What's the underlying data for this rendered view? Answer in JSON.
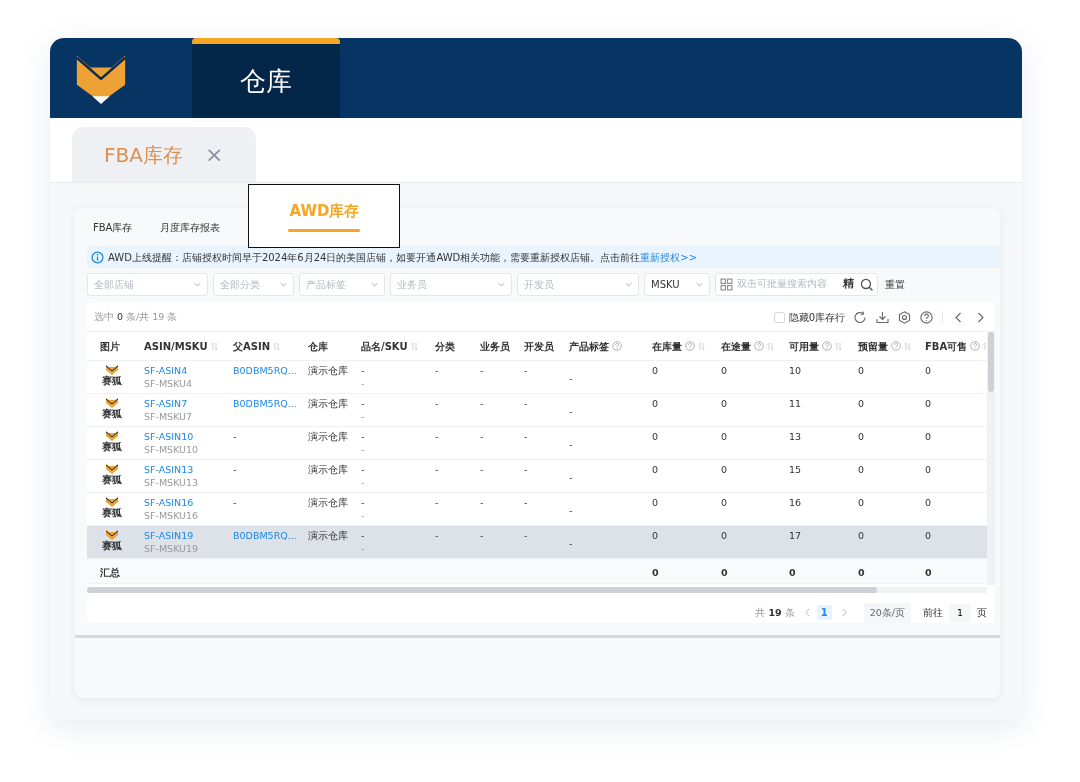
{
  "header": {
    "module_tab": {
      "label": "仓库",
      "selected": true
    }
  },
  "page_tabs": [
    {
      "label": "FBA库存",
      "selected": true,
      "close_glyph": "×"
    }
  ],
  "sub_tabs": [
    {
      "label": "FBA库存",
      "selected": false
    },
    {
      "label": "月度库存报表",
      "selected": false
    },
    {
      "label": "AWD库存",
      "selected": true
    }
  ],
  "alert": {
    "text": "AWD上线提醒：店铺授权时间早于2024年6月24日的美国店铺，如要开通AWD相关功能，需要重新授权店铺。点击前往",
    "link": "重新授权>>"
  },
  "filters": [
    {
      "placeholder": "全部店铺"
    },
    {
      "placeholder": "全部分类"
    },
    {
      "placeholder": "产品标签"
    },
    {
      "placeholder": "业务员"
    },
    {
      "placeholder": "开发员"
    }
  ],
  "search": {
    "field_select": "MSKU",
    "placeholder": "双击可批量搜索内容",
    "exact_button": "精",
    "reset_button": "重置"
  },
  "toolbar": {
    "selection": "选中 **0** 条/共 19 条",
    "hide_zero": {
      "label": "隐藏0库存行",
      "checked": false
    }
  },
  "table": {
    "columns": [
      {
        "label": "图片",
        "help": false,
        "sortable": false
      },
      {
        "label": "ASIN/MSKU",
        "help": false,
        "sortable": true
      },
      {
        "label": "父ASIN",
        "help": false,
        "sortable": true
      },
      {
        "label": "仓库",
        "help": false,
        "sortable": false
      },
      {
        "label": "品名/SKU",
        "help": false,
        "sortable": true
      },
      {
        "label": "分类",
        "help": false,
        "sortable": false
      },
      {
        "label": "业务员",
        "help": false,
        "sortable": false
      },
      {
        "label": "开发员",
        "help": false,
        "sortable": false
      },
      {
        "label": "产品标签",
        "help": true,
        "sortable": false
      },
      {
        "label": "在库量",
        "help": true,
        "sortable": true
      },
      {
        "label": "在途量",
        "help": true,
        "sortable": true
      },
      {
        "label": "可用量",
        "help": true,
        "sortable": true
      },
      {
        "label": "预留量",
        "help": true,
        "sortable": true
      },
      {
        "label": "FBA可售",
        "help": true,
        "sortable": true
      }
    ],
    "rows": [
      {
        "image_caption": "赛狐",
        "asin": "SF-ASIN4",
        "msku": "SF-MSKU4",
        "parent_asin": "B0DBM5RQ...",
        "warehouse": "演示仓库",
        "name": "-",
        "sku": "-",
        "category": "-",
        "sales": "-",
        "developer": "-",
        "tag": "-",
        "in_stock": "0",
        "in_transit": "0",
        "available": "10",
        "reserved": "0",
        "fba_sellable": "0",
        "highlighted": false
      },
      {
        "image_caption": "赛狐",
        "asin": "SF-ASIN7",
        "msku": "SF-MSKU7",
        "parent_asin": "B0DBM5RQ...",
        "warehouse": "演示仓库",
        "name": "-",
        "sku": "-",
        "category": "-",
        "sales": "-",
        "developer": "-",
        "tag": "-",
        "in_stock": "0",
        "in_transit": "0",
        "available": "11",
        "reserved": "0",
        "fba_sellable": "0",
        "highlighted": false
      },
      {
        "image_caption": "赛狐",
        "asin": "SF-ASIN10",
        "msku": "SF-MSKU10",
        "parent_asin": "-",
        "warehouse": "演示仓库",
        "name": "-",
        "sku": "-",
        "category": "-",
        "sales": "-",
        "developer": "-",
        "tag": "-",
        "in_stock": "0",
        "in_transit": "0",
        "available": "13",
        "reserved": "0",
        "fba_sellable": "0",
        "highlighted": false
      },
      {
        "image_caption": "赛狐",
        "asin": "SF-ASIN13",
        "msku": "SF-MSKU13",
        "parent_asin": "-",
        "warehouse": "演示仓库",
        "name": "-",
        "sku": "-",
        "category": "-",
        "sales": "-",
        "developer": "-",
        "tag": "-",
        "in_stock": "0",
        "in_transit": "0",
        "available": "15",
        "reserved": "0",
        "fba_sellable": "0",
        "highlighted": false
      },
      {
        "image_caption": "赛狐",
        "asin": "SF-ASIN16",
        "msku": "SF-MSKU16",
        "parent_asin": "-",
        "warehouse": "演示仓库",
        "name": "-",
        "sku": "-",
        "category": "-",
        "sales": "-",
        "developer": "-",
        "tag": "-",
        "in_stock": "0",
        "in_transit": "0",
        "available": "16",
        "reserved": "0",
        "fba_sellable": "0",
        "highlighted": false
      },
      {
        "image_caption": "赛狐",
        "asin": "SF-ASIN19",
        "msku": "SF-MSKU19",
        "parent_asin": "B0DBM5RQ...",
        "warehouse": "演示仓库",
        "name": "-",
        "sku": "-",
        "category": "-",
        "sales": "-",
        "developer": "-",
        "tag": "-",
        "in_stock": "0",
        "in_transit": "0",
        "available": "17",
        "reserved": "0",
        "fba_sellable": "0",
        "highlighted": true
      }
    ],
    "summary": {
      "label": "汇总",
      "in_stock": "0",
      "in_transit": "0",
      "available": "0",
      "reserved": "0",
      "fba_sellable": "0"
    }
  },
  "pagination": {
    "total_prefix": "共",
    "total": "19",
    "total_suffix": "条",
    "pages": [
      {
        "label": "1",
        "selected": true
      }
    ],
    "page_size": "20条/页",
    "goto_label": "前往",
    "goto_value": "1",
    "goto_suffix": "页"
  }
}
